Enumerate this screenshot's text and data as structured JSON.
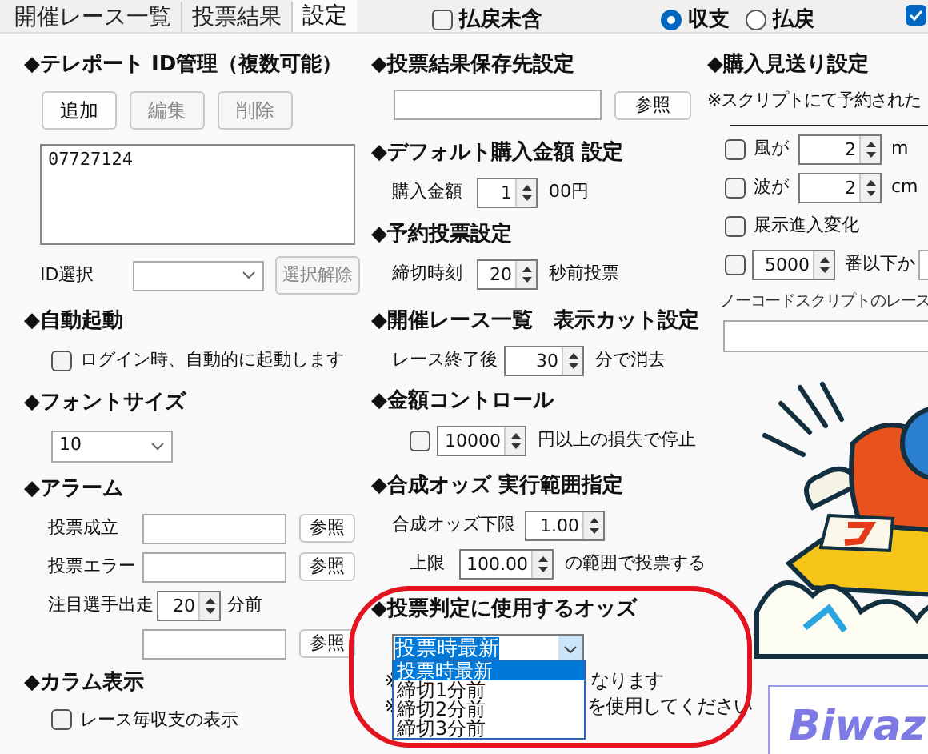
{
  "tabs": [
    {
      "label": "開催レース一覧",
      "selected": false
    },
    {
      "label": "投票結果",
      "selected": false
    },
    {
      "label": "設定",
      "selected": true
    }
  ],
  "filters": {
    "exclude_payout": {
      "label": "払戻未含",
      "checked": false
    },
    "modes": [
      {
        "label": "収支",
        "selected": true
      },
      {
        "label": "払戻",
        "selected": false
      }
    ],
    "extra_checkbox": {
      "checked": true
    }
  },
  "teleport": {
    "title": "◆テレポート ID管理（複数可能）",
    "buttons": [
      {
        "label": "追加",
        "disabled": false
      },
      {
        "label": "編集",
        "disabled": true
      },
      {
        "label": "削除",
        "disabled": true
      }
    ],
    "ids": [
      "07727124"
    ],
    "select_label": "ID選択",
    "clear_button": {
      "label": "選択解除",
      "disabled": true
    }
  },
  "auto_start": {
    "title": "◆自動起動",
    "checkbox": {
      "label": "ログイン時、自動的に起動します",
      "checked": false
    }
  },
  "font_size": {
    "title": "◆フォントサイズ",
    "value": "10"
  },
  "alarm": {
    "title": "◆アラーム",
    "rows": [
      {
        "kind": "file",
        "label": "投票成立",
        "button": "参照"
      },
      {
        "kind": "file",
        "label": "投票エラー",
        "button": "参照"
      },
      {
        "kind": "spinner",
        "label": "注目選手出走",
        "value": "20",
        "unit": "分前"
      },
      {
        "kind": "file",
        "button": "参照"
      }
    ]
  },
  "column_display": {
    "title": "◆カラム表示",
    "checkbox": {
      "label": "レース毎収支の表示",
      "checked": false
    }
  },
  "result_save": {
    "title": "◆投票結果保存先設定",
    "button": "参照"
  },
  "default_amount": {
    "title": "◆デフォルト購入金額 設定",
    "label": "購入金額",
    "value": "1",
    "unit": "00円"
  },
  "reserve": {
    "title": "◆予約投票設定",
    "label": "締切時刻",
    "value": "20",
    "unit": "秒前投票"
  },
  "race_cut": {
    "title": "◆開催レース一覧　表示カット設定",
    "label": "レース終了後",
    "value": "30",
    "unit": "分で消去"
  },
  "amount_control": {
    "title": "◆金額コントロール",
    "checked": false,
    "value": "10000",
    "unit": "円以上の損失で停止"
  },
  "combined_odds": {
    "title": "◆合成オッズ 実行範囲指定",
    "lower_label": "合成オッズ下限",
    "lower": "1.00",
    "upper_label": "上限",
    "upper": "100.00",
    "unit": "の範囲で投票する"
  },
  "odds_used": {
    "title": "◆投票判定に使用するオッズ",
    "value": "投票時最新",
    "expanded": true,
    "options": [
      {
        "label": "投票時最新",
        "selected": true
      },
      {
        "label": "締切1分前",
        "selected": false
      },
      {
        "label": "締切2分前",
        "selected": false
      },
      {
        "label": "締切3分前",
        "selected": false
      }
    ],
    "notes": [
      {
        "lead": "※",
        "tail": "なります"
      },
      {
        "lead": "※",
        "tail": "を使用してください"
      }
    ]
  },
  "skip": {
    "title": "◆購入見送り設定",
    "note": "※スクリプトにて予約された",
    "rows": [
      {
        "kind": "spinner",
        "checked": false,
        "label": "風が",
        "value": "2",
        "unit": "m"
      },
      {
        "kind": "spinner",
        "checked": false,
        "label": "波が",
        "value": "2",
        "unit": "cm"
      },
      {
        "kind": "check",
        "checked": false,
        "label": "展示進入変化"
      },
      {
        "kind": "spinner",
        "checked": false,
        "value": "5000",
        "unit": "番以下か",
        "trailing_field": true
      }
    ],
    "script_label": "ノーコードスクリプトのレース"
  },
  "logo": {
    "text": "Biwaz"
  }
}
